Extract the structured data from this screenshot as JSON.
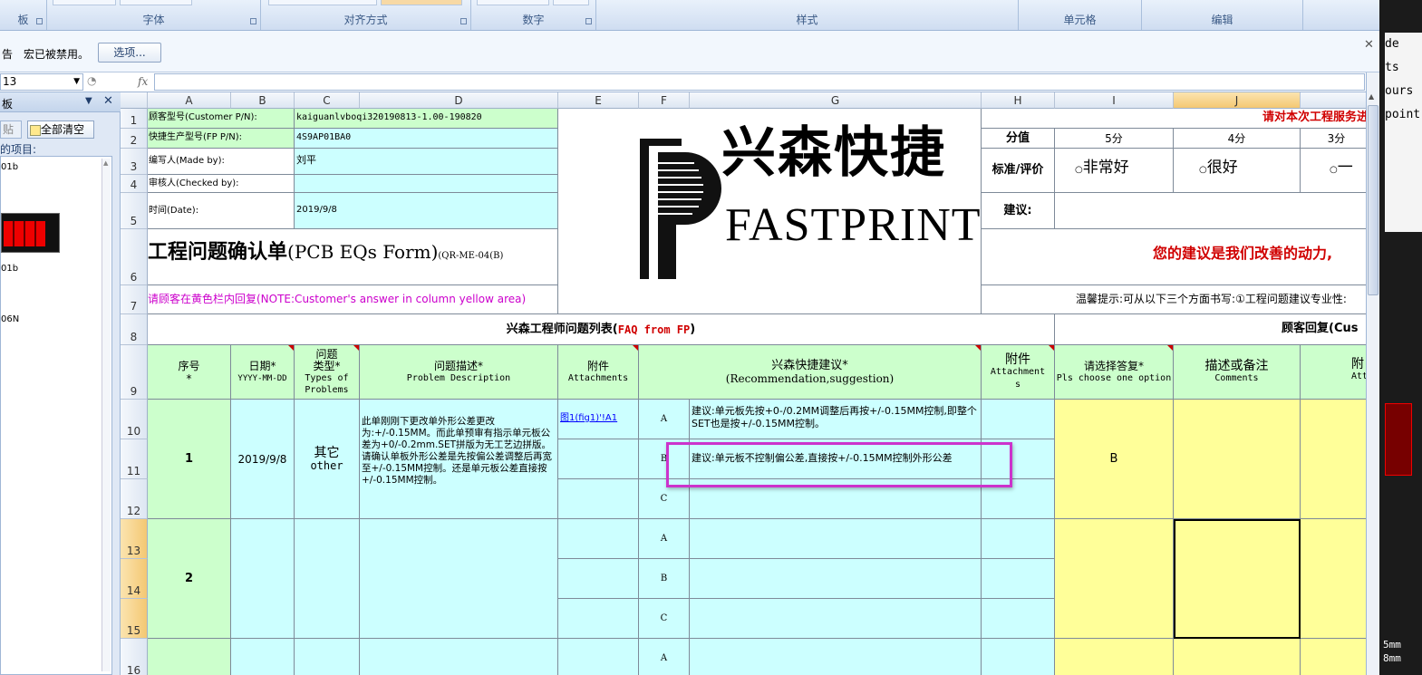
{
  "ribbon": {
    "groups": [
      {
        "label": "板"
      },
      {
        "label": "字体"
      },
      {
        "label": "对齐方式"
      },
      {
        "label": "数字"
      },
      {
        "label": "样式"
      },
      {
        "label": "单元格"
      },
      {
        "label": "编辑"
      }
    ]
  },
  "security_bar": {
    "warning_prefix": "告",
    "message": "宏已被禁用。",
    "options_button": "选项..."
  },
  "formula_bar": {
    "name_box": "13",
    "fx_label": "fx",
    "content": ""
  },
  "clipboard": {
    "title": "板",
    "paste_all": "贴",
    "clear_all": "全部清空",
    "items_label": "的项目:",
    "items": [
      "01b",
      "01b",
      "06N"
    ]
  },
  "columns": [
    "A",
    "B",
    "C",
    "D",
    "E",
    "F",
    "G",
    "H",
    "I",
    "J"
  ],
  "rows": [
    "1",
    "2",
    "3",
    "4",
    "5",
    "6",
    "7",
    "8",
    "9",
    "10",
    "11",
    "12",
    "13",
    "14",
    "15",
    "16"
  ],
  "header_info": {
    "customer_pn_label": "顾客型号(Customer P/N):",
    "customer_pn_value": "kaiguanlvboqi320190813-1.00-190820",
    "fp_pn_label": "快捷生产型号(FP P/N):",
    "fp_pn_value": "4S9AP01BA0",
    "made_by_label": "编写人(Made by):",
    "made_by_value": "刘平",
    "checked_by_label": "审核人(Checked by):",
    "checked_by_value": "",
    "date_label": "时间(Date):",
    "date_value": "2019/9/8",
    "form_title": "工程问题确认单",
    "form_title_en": "(PCB EQs Form)",
    "form_code": "(QR-ME-04(B)",
    "note": "请顾客在黄色栏内回复(NOTE:Customer's answer in column yellow area)"
  },
  "logo": {
    "cn": "兴森快捷",
    "en": "FASTPRINT"
  },
  "rating": {
    "prompt": "请对本次工程服务进",
    "score_label": "分值",
    "score_5": "5分",
    "score_4": "4分",
    "score_3": "3分",
    "eval_label": "标准/评价",
    "opt_5": "非常好",
    "opt_4": "很好",
    "opt_3": "一",
    "suggest_label": "建议:",
    "slogan": "您的建议是我们改善的动力,",
    "tip": "温馨提示:可从以下三个方面书写:①工程问题建议专业性:"
  },
  "faq": {
    "fp_title": "兴森工程师问题列表(",
    "fp_title_red": "FAQ from FP",
    "fp_title_end": ")",
    "customer_title": "顾客回复(Cus",
    "col_seq": "序号",
    "col_seq_star": "*",
    "col_date": "日期*",
    "col_date_fmt": "YYYY-MM-DD",
    "col_type": "问题",
    "col_type2": "类型*",
    "col_type_en": "Types of",
    "col_type_en2": "Problems",
    "col_desc": "问题描述*",
    "col_desc_en": "Problem Description",
    "col_att": "附件",
    "col_att_en": "Attachments",
    "col_rec": "兴森快捷建议*",
    "col_rec_en": "(Recommendation,suggestion)",
    "col_att2": "附件",
    "col_att2_en": "Attachment",
    "col_att2_en2": "s",
    "col_choose": "请选择答复*",
    "col_choose_en": "Pls choose one option",
    "col_comments": "描述或备注",
    "col_comments_en": "Comments",
    "col_att3": "附",
    "col_att3_en": "Attac"
  },
  "issues": [
    {
      "seq": "1",
      "date": "2019/9/8",
      "type": "其它",
      "type_en": "other",
      "description": "此单刚刚下更改单外形公差更改为:+/-0.15MM。而此单预审有指示单元板公差为+0/-0.2mm.SET拼版为无工艺边拼版。请确认单板外形公差是先按偏公差调整后再宽至+/-0.15MM控制。还是单元板公差直接按+/-0.15MM控制。",
      "attachment": "图1(fig1)'!A1",
      "options": [
        "A",
        "B",
        "C"
      ],
      "recommendations": [
        "建议:单元板先按+0-/0.2MM调整后再按+/-0.15MM控制,即整个SET也是按+/-0.15MM控制。",
        "建议:单元板不控制偏公差,直接按+/-0.15MM控制外形公差",
        ""
      ],
      "answer": "B"
    },
    {
      "seq": "2",
      "date": "",
      "type": "",
      "type_en": "",
      "description": "",
      "attachment": "",
      "options": [
        "A",
        "B",
        "C"
      ],
      "recommendations": [
        "",
        "",
        ""
      ],
      "answer": ""
    },
    {
      "options": [
        "A"
      ]
    }
  ],
  "right_panel": {
    "lines": [
      "de",
      "ts",
      "ours",
      "",
      "",
      "",
      "point",
      ""
    ],
    "bottom1": "5mm",
    "bottom2": "8mm"
  }
}
